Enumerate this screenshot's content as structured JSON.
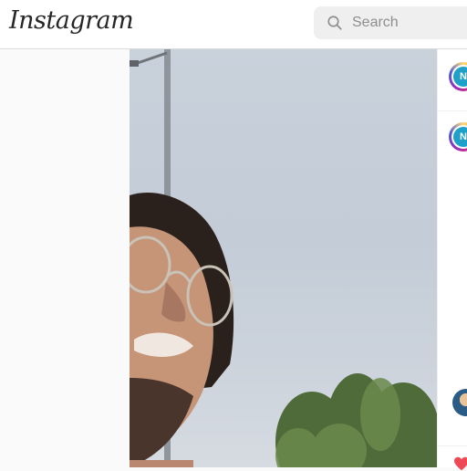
{
  "header": {
    "logo_text": "Instagram",
    "search": {
      "placeholder": "Search",
      "icon": "search-icon"
    }
  },
  "side_panel": {
    "avatars": [
      {
        "initial": "N",
        "icon": "story-avatar"
      },
      {
        "initial": "N",
        "icon": "story-avatar"
      }
    ],
    "comment_avatar": "user-avatar",
    "like_icon": "heart-icon",
    "like_color": "#ed4956"
  },
  "colors": {
    "header_bg": "#ffffff",
    "page_bg": "#fafafa",
    "search_bg": "#efefef",
    "text_primary": "#262626",
    "text_secondary": "#8e8e8e"
  }
}
